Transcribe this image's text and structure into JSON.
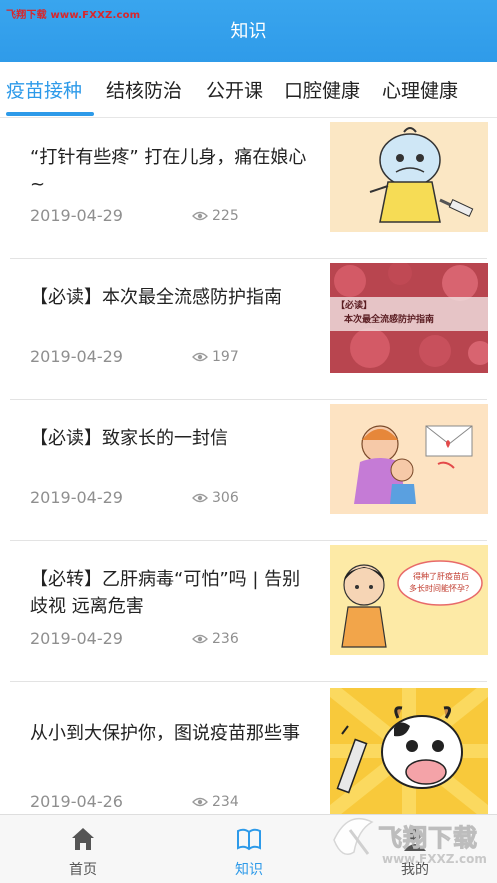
{
  "watermark": "飞翔下载 www.FXXZ.com",
  "header": {
    "title": "知识"
  },
  "tabs": [
    {
      "label": "疫苗接种",
      "active": true
    },
    {
      "label": "结核防治",
      "active": false
    },
    {
      "label": "公开课",
      "active": false
    },
    {
      "label": "口腔健康",
      "active": false
    },
    {
      "label": "心理健康",
      "active": false
    }
  ],
  "articles": [
    {
      "title": "“打针有些疼” 打在儿身，痛在娘心~",
      "date": "2019-04-29",
      "views": "225",
      "thumb": "cartoon-baby-injection-image"
    },
    {
      "title": "【必读】本次最全流感防护指南",
      "date": "2019-04-29",
      "views": "197",
      "thumb": "flu-virus-image",
      "thumb_text": [
        "【必读】",
        "本次最全流感防护指南"
      ]
    },
    {
      "title": "【必读】致家长的一封信",
      "date": "2019-04-29",
      "views": "306",
      "thumb": "mother-child-letter-image"
    },
    {
      "title": "【必转】乙肝病毒“可怕”吗 | 告别歧视 远离危害",
      "date": "2019-04-29",
      "views": "236",
      "thumb": "cartoon-girl-question-image",
      "thumb_text": [
        "得种了肝疫苗后",
        "多长时间能怀孕？"
      ]
    },
    {
      "title": "从小到大保护你，图说疫苗那些事",
      "date": "2019-04-26",
      "views": "234",
      "thumb": "cartoon-cow-vaccine-image"
    }
  ],
  "bottom_nav": [
    {
      "label": "首页",
      "icon": "home-icon",
      "active": false
    },
    {
      "label": "知识",
      "icon": "book-icon",
      "active": true
    },
    {
      "label": "我的",
      "icon": "user-icon",
      "active": false
    }
  ],
  "bottom_watermark": {
    "brand": "飞翔下载",
    "url": "www.FXXZ.com"
  },
  "colors": {
    "primary": "#2d9ae9",
    "header": "#39a5ee",
    "text": "#222222",
    "muted": "#8f8f8f"
  }
}
